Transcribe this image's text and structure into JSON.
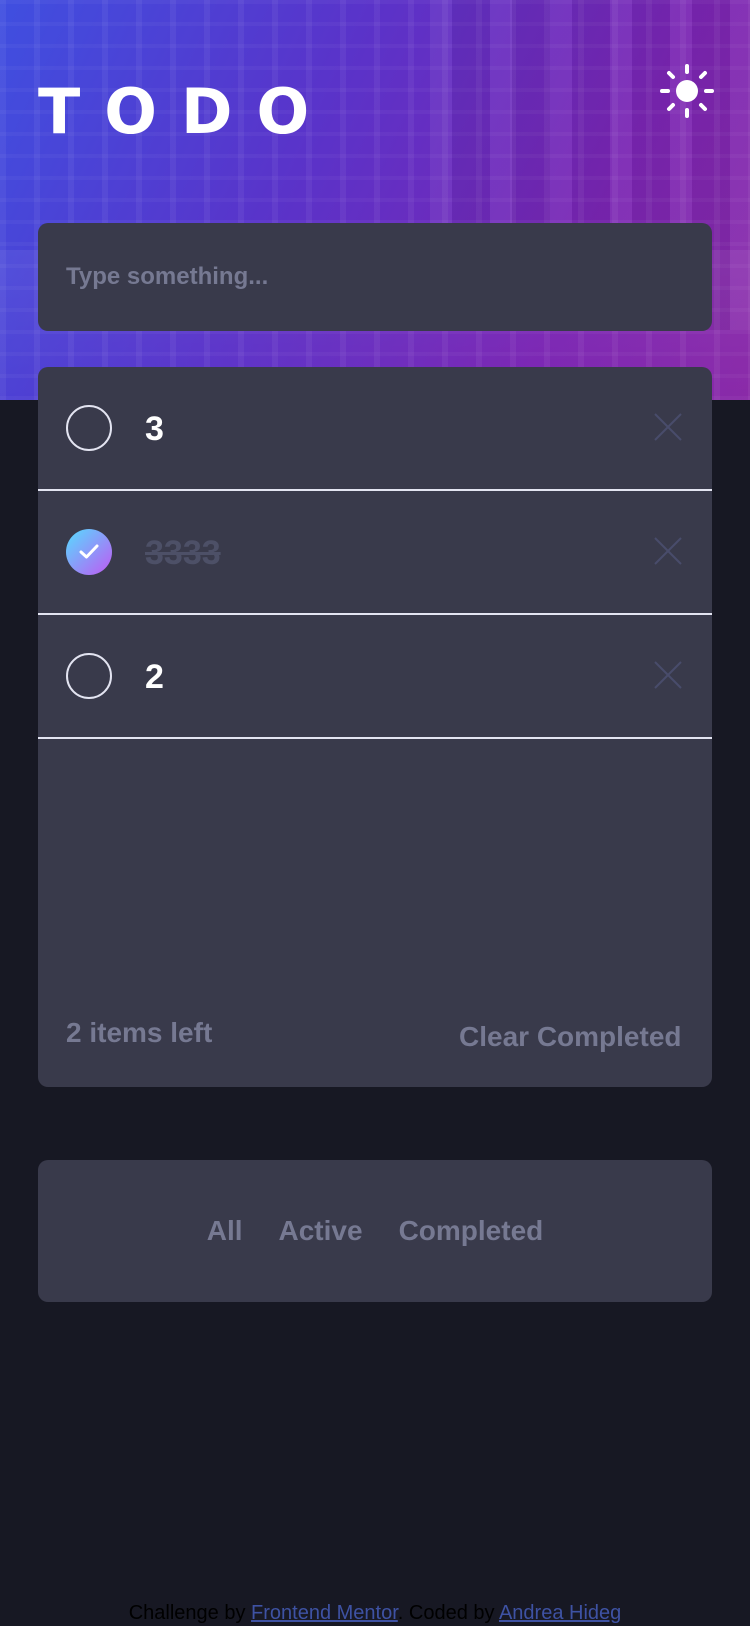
{
  "header": {
    "title": "TODO",
    "theme_icon": "sun-icon"
  },
  "new_todo": {
    "placeholder": "Type something...",
    "value": ""
  },
  "todos": [
    {
      "text": "3",
      "completed": false
    },
    {
      "text": "3333",
      "completed": true
    },
    {
      "text": "2",
      "completed": false
    }
  ],
  "list_footer": {
    "items_left": "2 items left",
    "clear_completed": "Clear Completed"
  },
  "filters": {
    "all": "All",
    "active": "Active",
    "completed": "Completed"
  },
  "footer": {
    "prefix": "Challenge by ",
    "link1": "Frontend Mentor",
    "middle": ". Coded by ",
    "link2": "Andrea Hideg"
  },
  "colors": {
    "card": "#393a4b",
    "background": "#171823",
    "muted_text": "#767992",
    "check_gradient_start": "#55ddff",
    "check_gradient_end": "#c058f3",
    "link": "#3e52a3"
  }
}
